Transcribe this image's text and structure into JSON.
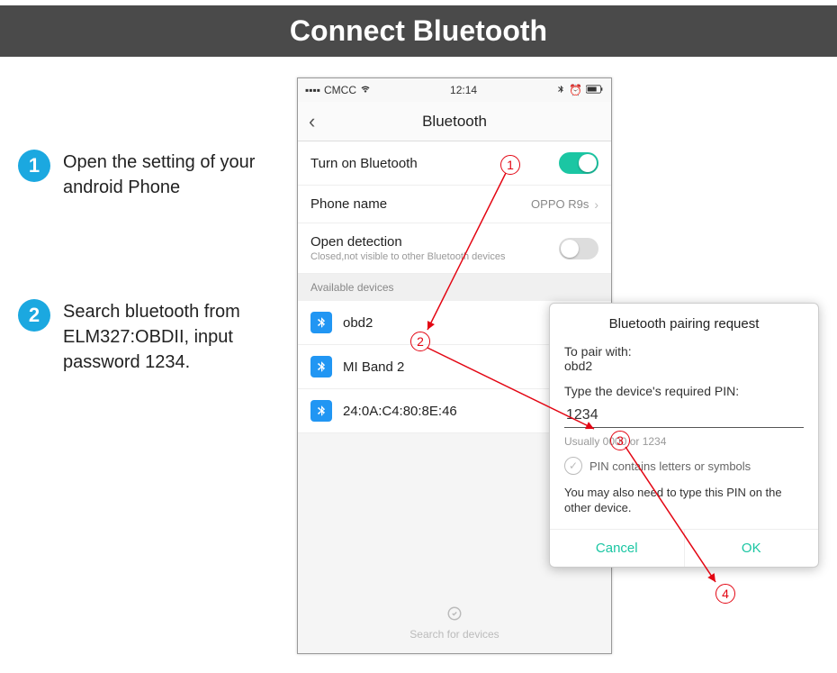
{
  "header": {
    "title": "Connect Bluetooth"
  },
  "steps": [
    {
      "num": "1",
      "text": "Open the setting of your android Phone"
    },
    {
      "num": "2",
      "text": "Search bluetooth from ELM327:OBDII, input password 1234."
    }
  ],
  "phone": {
    "statusbar": {
      "carrier": "CMCC",
      "time": "12:14"
    },
    "navbar": {
      "back": "‹",
      "title": "Bluetooth"
    },
    "rows": {
      "turn_on": "Turn on Bluetooth",
      "phone_name_label": "Phone name",
      "phone_name_value": "OPPO R9s",
      "open_detection": "Open detection",
      "open_detection_sub": "Closed,not visible to other Bluetooth devices"
    },
    "section_available": "Available devices",
    "devices": [
      {
        "name": "obd2"
      },
      {
        "name": "MI Band 2"
      },
      {
        "name": "24:0A:C4:80:8E:46"
      }
    ],
    "footer": "Search for devices"
  },
  "dialog": {
    "title": "Bluetooth pairing request",
    "pair_with_label": "To pair with:",
    "pair_with_value": "obd2",
    "pin_prompt": "Type the device's required PIN:",
    "pin_value": "1234",
    "pin_hint": "Usually 0000 or 1234",
    "checkbox_label": "PIN contains letters or symbols",
    "note": "You may also need to type this PIN on the other device.",
    "cancel": "Cancel",
    "ok": "OK"
  },
  "markers": {
    "m1": "1",
    "m2": "2",
    "m3": "3",
    "m4": "4"
  }
}
